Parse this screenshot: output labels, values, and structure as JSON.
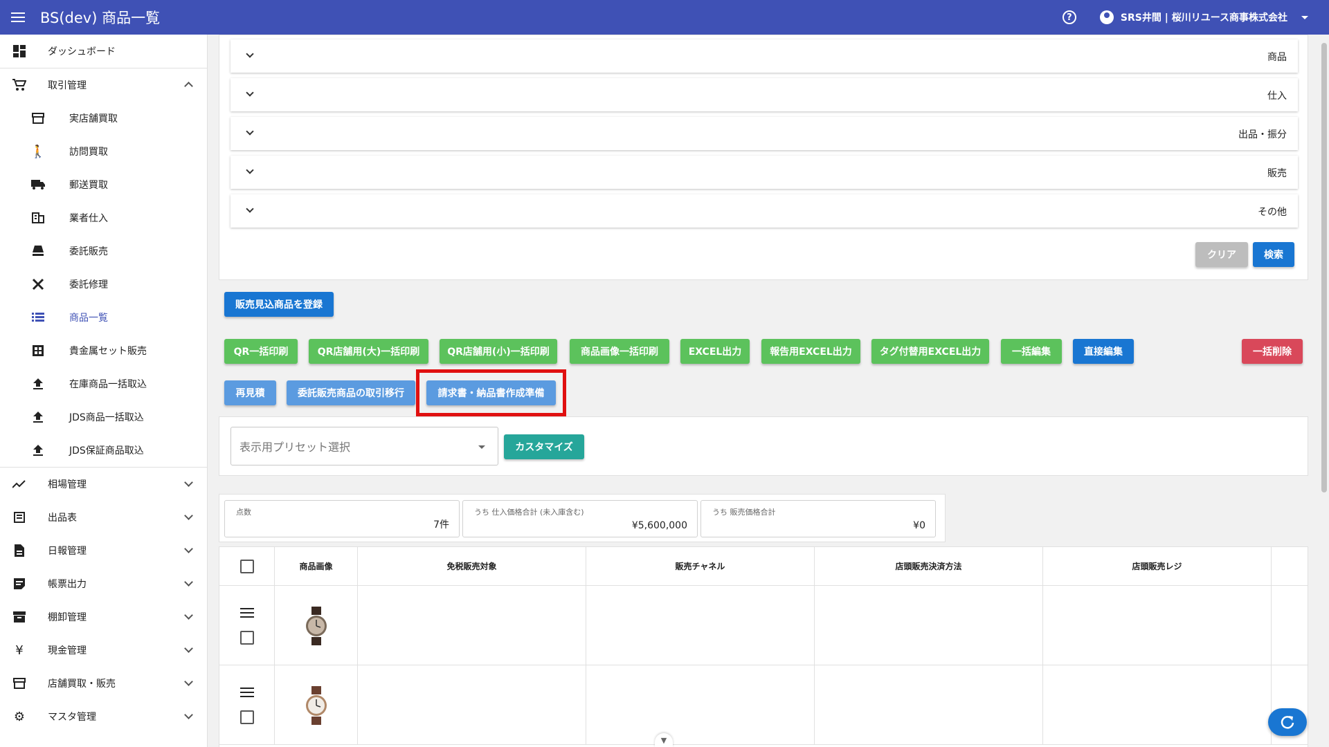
{
  "app": {
    "title": "BS(dev) 商品一覧",
    "user": "SRS井間 | 桜川リユース商事株式会社"
  },
  "sidebar": {
    "top": {
      "label": "ダッシュボード",
      "icon": "dashboard-icon"
    },
    "trade": {
      "label": "取引管理",
      "icon": "cart-icon"
    },
    "sub_items": [
      {
        "label": "実店舗買取",
        "icon": "store-icon"
      },
      {
        "label": "訪問買取",
        "icon": "walk-icon"
      },
      {
        "label": "郵送買取",
        "icon": "truck-icon"
      },
      {
        "label": "業者仕入",
        "icon": "building-icon"
      },
      {
        "label": "委託販売",
        "icon": "lamp-icon"
      },
      {
        "label": "委託修理",
        "icon": "tools-icon"
      },
      {
        "label": "商品一覧",
        "icon": "list-icon"
      },
      {
        "label": "貴金属セット販売",
        "icon": "grid-icon"
      },
      {
        "label": "在庫商品一括取込",
        "icon": "upload-icon"
      },
      {
        "label": "JDS商品一括取込",
        "icon": "upload-icon"
      },
      {
        "label": "JDS保証商品取込",
        "icon": "upload-icon"
      }
    ],
    "groups": [
      {
        "label": "相場管理",
        "icon": "trend-icon"
      },
      {
        "label": "出品表",
        "icon": "sheet-icon"
      },
      {
        "label": "日報管理",
        "icon": "document-icon"
      },
      {
        "label": "帳票出力",
        "icon": "note-icon"
      },
      {
        "label": "棚卸管理",
        "icon": "archive-icon"
      },
      {
        "label": "現金管理",
        "icon": "yen-icon"
      },
      {
        "label": "店舗買取・販売",
        "icon": "store-icon"
      },
      {
        "label": "マスタ管理",
        "icon": "gear-icon"
      }
    ]
  },
  "filters": {
    "sections": [
      "商品",
      "仕入",
      "出品・振分",
      "販売",
      "その他"
    ],
    "clear_label": "クリア",
    "search_label": "検索"
  },
  "actions": {
    "register": "販売見込商品を登録",
    "row1": [
      "QR一括印刷",
      "QR店舗用(大)一括印刷",
      "QR店舗用(小)一括印刷",
      "商品画像一括印刷",
      "EXCEL出力",
      "報告用EXCEL出力",
      "タグ付替用EXCEL出力",
      "一括編集"
    ],
    "direct_edit": "直接編集",
    "bulk_delete": "一括削除",
    "row2": [
      "再見積",
      "委託販売商品の取引移行"
    ],
    "invoice": "請求書・納品書作成準備"
  },
  "preset": {
    "placeholder": "表示用プリセット選択",
    "customize": "カスタマイズ"
  },
  "stats": [
    {
      "label": "点数",
      "value": "7件"
    },
    {
      "label": "うち 仕入価格合計 (未入庫含む)",
      "value": "¥5,600,000"
    },
    {
      "label": "うち 販売価格合計",
      "value": "¥0"
    }
  ],
  "table": {
    "columns": [
      "商品画像",
      "免税販売対象",
      "販売チャネル",
      "店頭販売決済方法",
      "店頭販売レジ"
    ]
  },
  "colors": {
    "appbar": "#3f51b5",
    "primary": "#1976d2",
    "success": "#5cc25c",
    "danger": "#d9485a",
    "teal": "#26a69a"
  }
}
